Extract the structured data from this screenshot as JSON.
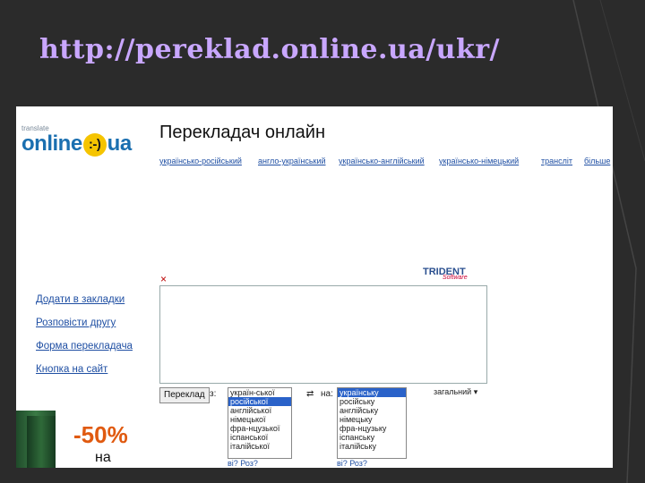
{
  "slide": {
    "title": "http://pereklad.online.ua/ukr/"
  },
  "logo": {
    "small": "translate",
    "main_left": "online",
    "smile": ":-)",
    "main_right": "ua"
  },
  "header": {
    "title": "Перекладач онлайн"
  },
  "nav": [
    "українсько-російський",
    "англо-український",
    "українсько-англійський",
    "українсько-німецький",
    "трансліт",
    "більше"
  ],
  "sidebar": [
    "Додати в закладки",
    "Розповісти другу",
    "Форма перекладача",
    "Кнопка на сайт"
  ],
  "editor": {
    "close": "×",
    "brand": "TRIDENT",
    "brand_sub": "Software"
  },
  "controls": {
    "translate_button": "Переклад",
    "from_label": "з:",
    "to_label": "на:",
    "swap": "⇄",
    "from_list": [
      "україн-ської",
      "російської",
      "англійської",
      "німецької",
      "фра-нцузької",
      "іспанської",
      "італійської"
    ],
    "from_selected_index": 1,
    "to_list": [
      "українську",
      "російську",
      "англійську",
      "німецьку",
      "фра-нцузьку",
      "іспанську",
      "італійську"
    ],
    "to_selected_index": 0,
    "dropdown_value": "загальний",
    "dropdown_arrow": "▾"
  },
  "promo": {
    "percent": "-50%",
    "text": "на"
  },
  "bottom": {
    "left": "ві? Роз?",
    "right": "ві? Роз?"
  }
}
